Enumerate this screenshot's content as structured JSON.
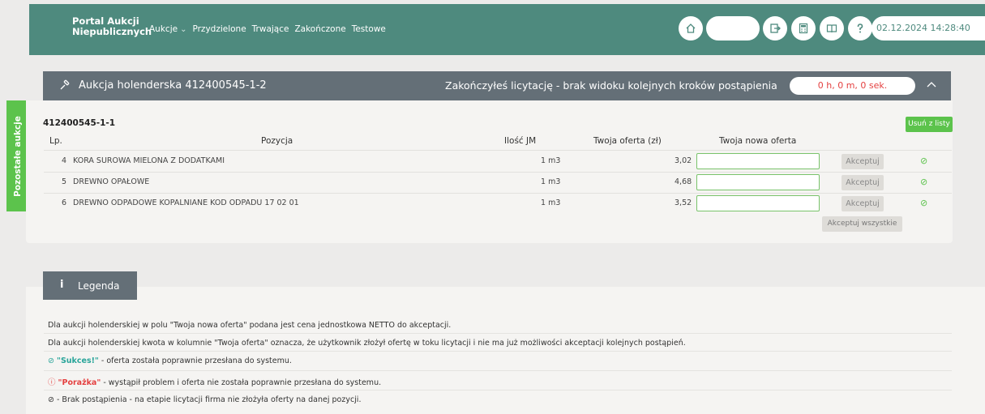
{
  "header": {
    "brand_line1": "Portal Aukcji",
    "brand_line2": "Niepublicznych",
    "nav": [
      {
        "label": "Aukcje",
        "chevron": "⌄"
      },
      {
        "label": "Przydzielone"
      },
      {
        "label": "Trwające"
      },
      {
        "label": "Zakończone"
      },
      {
        "label": "Testowe"
      }
    ],
    "icons": [
      "home-icon",
      "logout-icon",
      "calculator-icon",
      "book-icon",
      "help-icon",
      "phone-icon"
    ],
    "datetime": "02.12.2024 14:28:40",
    "accent_color": "#4e8a7e"
  },
  "side_tab": {
    "label": "Pozostałe aukcje"
  },
  "auction": {
    "title": "Aukcja holenderska 412400545-1-2",
    "ended_message": "Zakończyłeś licytację - brak widoku kolejnych kroków postąpienia",
    "timer": "0 h, 0 m, 0 sek.",
    "id_label": "412400545-1-1",
    "remove_label": "Usuń z listy",
    "columns": {
      "lp": "Lp.",
      "position": "Pozycja",
      "qty": "Ilość JM",
      "offer": "Twoja oferta (zł)",
      "new_offer": "Twoja nowa oferta"
    },
    "rows": [
      {
        "lp": "4",
        "name": "KORA SUROWA MIELONA Z DODATKAMI",
        "qty": "1 m3",
        "offer": "3,02",
        "accept": "Akceptuj"
      },
      {
        "lp": "5",
        "name": "DREWNO OPAŁOWE",
        "qty": "1 m3",
        "offer": "4,68",
        "accept": "Akceptuj"
      },
      {
        "lp": "6",
        "name": "DREWNO ODPADOWE KOPALNIANE KOD ODPADU 17 02 01",
        "qty": "1 m3",
        "offer": "3,52",
        "accept": "Akceptuj"
      }
    ],
    "accept_all_label": "Akceptuj wszystkie"
  },
  "legend": {
    "title": "Legenda",
    "line1": "Dla aukcji holenderskiej w polu \"Twoja nowa oferta\" podana jest cena jednostkowa NETTO do akceptacji.",
    "line2": "Dla aukcji holenderskiej kwota w kolumnie \"Twoja oferta\" oznacza, że użytkownik złożył ofertę w toku licytacji i nie ma już możliwości akceptacji kolejnych postąpień.",
    "success_label": "\"Sukces!\"",
    "success_text": " - oferta została poprawnie przesłana do systemu.",
    "failure_label": "\"Porażka\"",
    "failure_text": " - wystąpił problem i oferta nie została poprawnie przesłana do systemu.",
    "none_text": " - Brak postąpienia - na etapie licytacji firma nie złożyła oferty na danej pozycji."
  }
}
